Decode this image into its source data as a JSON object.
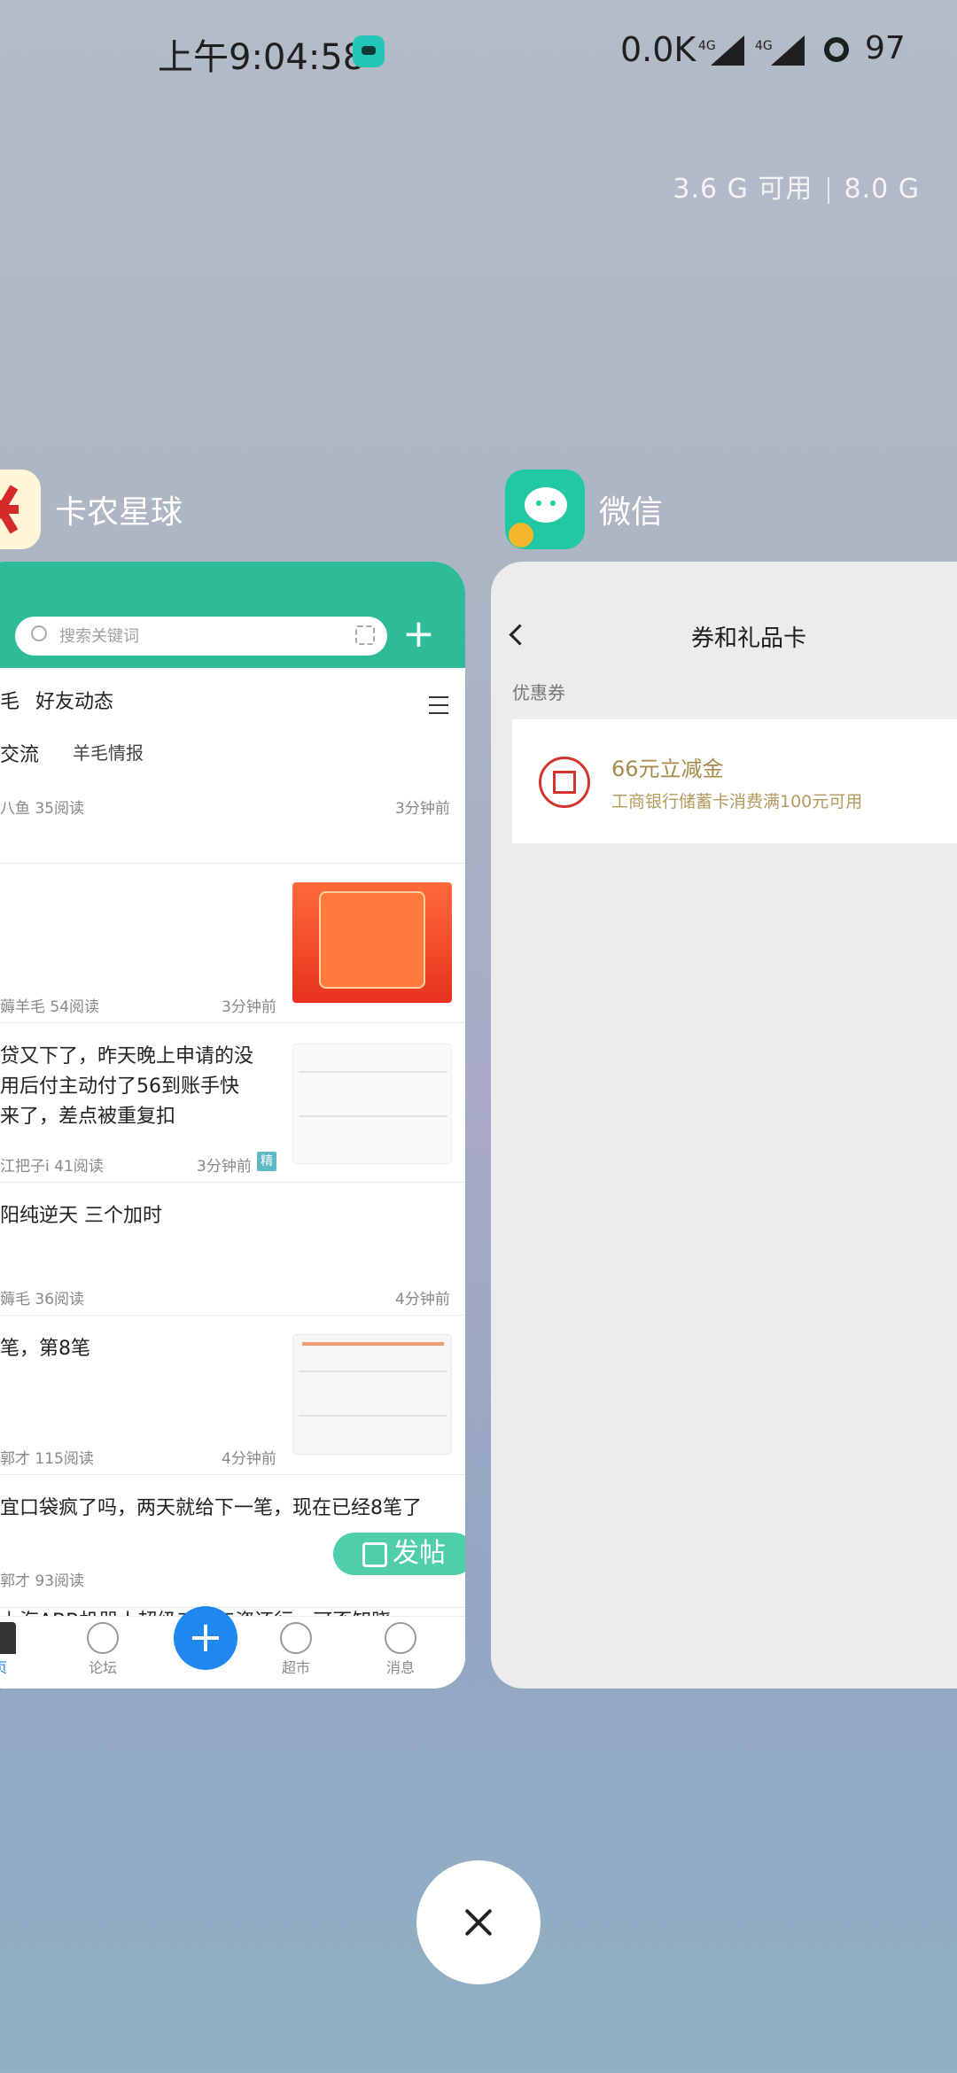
{
  "status_bar": {
    "time": "上午9:04:58",
    "net_speed": "0.0K",
    "sim1": "4G",
    "sim2": "4G",
    "battery": "97"
  },
  "memory": {
    "available": "3.6 G 可用",
    "total": "8.0 G"
  },
  "apps": {
    "kanong": {
      "name": "卡农星球",
      "search_placeholder": "搜索关键词",
      "tabs": [
        "毛",
        "好友动态"
      ],
      "subtabs": [
        "交流",
        "羊毛情报"
      ],
      "posts": [
        {
          "title": "",
          "meta": "八鱼   35阅读",
          "time": "3分钟前"
        },
        {
          "title": "",
          "meta": "薅羊毛   54阅读",
          "time": "3分钟前"
        },
        {
          "title": "贷又下了，昨天晚上申请的没\n用后付主动付了56到账手快\n来了，差点被重复扣",
          "meta": "江把子i   41阅读",
          "time": "3分钟前",
          "badge": "精"
        },
        {
          "title": "阳纯逆天 三个加时",
          "meta": "薅毛   36阅读",
          "time": "4分钟前"
        },
        {
          "title": "笔，第8笔",
          "meta": "郭才   115阅读",
          "time": "4分钟前"
        },
        {
          "title": "宜口袋疯了吗，两天就给下一笔，现在已经8笔了",
          "meta": "郭才   93阅读",
          "time": ""
        },
        {
          "title": "上海ABB机器人超级工厂工资还行。可否知晓。",
          "meta": "",
          "time": ""
        }
      ],
      "fab_label": "发帖",
      "bottom_nav": [
        {
          "label": "页"
        },
        {
          "label": "论坛"
        },
        {
          "label": "+"
        },
        {
          "label": "超市"
        },
        {
          "label": "消息"
        }
      ],
      "colors": {
        "brand": "#2dbc97",
        "accent": "#1e88f0"
      }
    },
    "wechat": {
      "name": "微信",
      "page_title": "券和礼品卡",
      "section": "优惠券",
      "coupon": {
        "title": "66元立减金",
        "subtitle": "工商银行储蓄卡消费满100元可用"
      }
    }
  }
}
